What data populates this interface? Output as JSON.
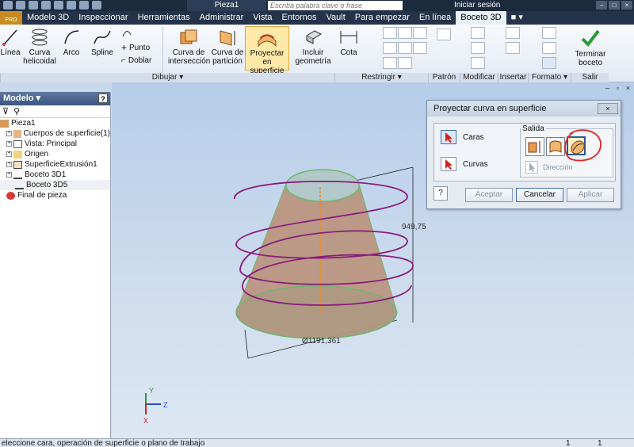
{
  "title_bar": {
    "document_title": "Pieza1",
    "search_placeholder": "Escriba palabra clave o frase",
    "sign_in": "Iniciar sesión"
  },
  "app_badge": "PRO",
  "menu": [
    "Modelo 3D",
    "Inspeccionar",
    "Herramientas",
    "Administrar",
    "Vista",
    "Entornos",
    "Vault",
    "Para empezar",
    "En línea",
    "Boceto 3D"
  ],
  "active_menu": "Boceto 3D",
  "ribbon": {
    "tools": {
      "linea": "Línea",
      "curva_helicoidal_1": "Curva",
      "curva_helicoidal_2": "helicoidal",
      "arco": "Arco",
      "spline": "Spline",
      "punto": "Punto",
      "doblar": "Doblar",
      "curva_interseccion_1": "Curva de",
      "curva_interseccion_2": "intersección",
      "curva_particion_1": "Curva de",
      "curva_particion_2": "partición",
      "proyectar_1": "Proyectar en",
      "proyectar_2": "superficie",
      "incluir_1": "Incluir",
      "incluir_2": "geometría",
      "cota": "Cota",
      "terminar_1": "Terminar",
      "terminar_2": "boceto"
    },
    "panels": {
      "dibujar": "Dibujar",
      "restringir": "Restringir",
      "patron": "Patrón",
      "modificar": "Modificar",
      "insertar": "Insertar",
      "formato": "Formato",
      "salir": "Salir"
    }
  },
  "browser": {
    "header": "Modelo",
    "help": "?",
    "items": [
      {
        "label": "Pieza1"
      },
      {
        "label": "Cuerpos de superficie(1)"
      },
      {
        "label": "Vista: Principal"
      },
      {
        "label": "Origen"
      },
      {
        "label": "SuperficieExtrusión1"
      },
      {
        "label": "Boceto 3D1"
      },
      {
        "label": "Boceto 3D5"
      },
      {
        "label": "Final de pieza"
      }
    ]
  },
  "viewport": {
    "dim_height": "949,75",
    "dim_diameter": "Ø1191,361",
    "axis_y": "Y",
    "axis_z": "Z",
    "axis_x": "X"
  },
  "dialog": {
    "title": "Proyectar curva en superficie",
    "caras": "Caras",
    "curvas": "Curvas",
    "salida": "Salida",
    "direccion": "Dirección",
    "help": "?",
    "aceptar": "Aceptar",
    "cancelar": "Cancelar",
    "aplicar": "Aplicar"
  },
  "status": {
    "message": "eleccione cara, operación de superficie o plano de trabajo",
    "count1": "1",
    "count2": "1"
  },
  "colors": {
    "helix": "#8a1c7c",
    "cone": "#b88e74",
    "face": "#6fb66f",
    "highlight": "#e0241f"
  }
}
